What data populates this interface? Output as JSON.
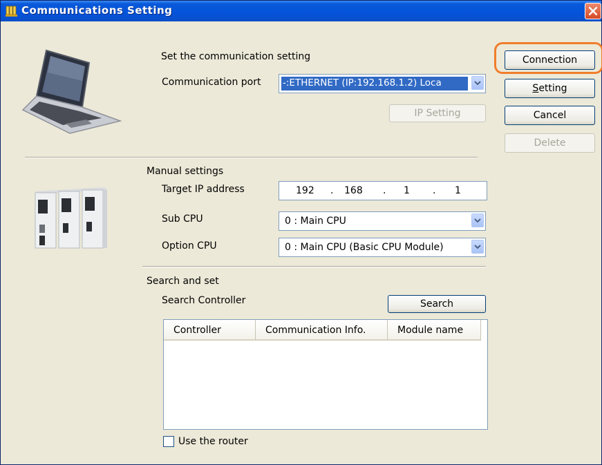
{
  "window": {
    "title": "Communications Setting"
  },
  "sidebar_buttons": {
    "connection": "Connection",
    "setting_rest": "etting",
    "setting_mnemonic": "S",
    "cancel": "Cancel",
    "delete": "Delete"
  },
  "comm": {
    "heading": "Set the communication setting",
    "port_label": "Communication port",
    "port_value": "-:ETHERNET  (IP:192.168.1.2) Loca",
    "ip_setting_button": "IP Setting"
  },
  "manual": {
    "heading": "Manual settings",
    "target_ip_label": "Target IP address",
    "ip": [
      "192",
      "168",
      "1",
      "1"
    ],
    "sub_cpu_label": "Sub CPU",
    "sub_cpu_value": "0 : Main CPU",
    "option_cpu_label": "Option CPU",
    "option_cpu_value": "0 : Main CPU (Basic CPU Module)"
  },
  "search": {
    "heading": "Search and set",
    "controller_label": "Search Controller",
    "search_button": "Search",
    "columns": [
      "Controller",
      "Communication Info.",
      "Module name"
    ],
    "use_router_label": "Use the router",
    "use_router_checked": false
  },
  "colors": {
    "titlebar": "#0553da",
    "highlight": "#f07d2c",
    "selection": "#316ac5"
  }
}
